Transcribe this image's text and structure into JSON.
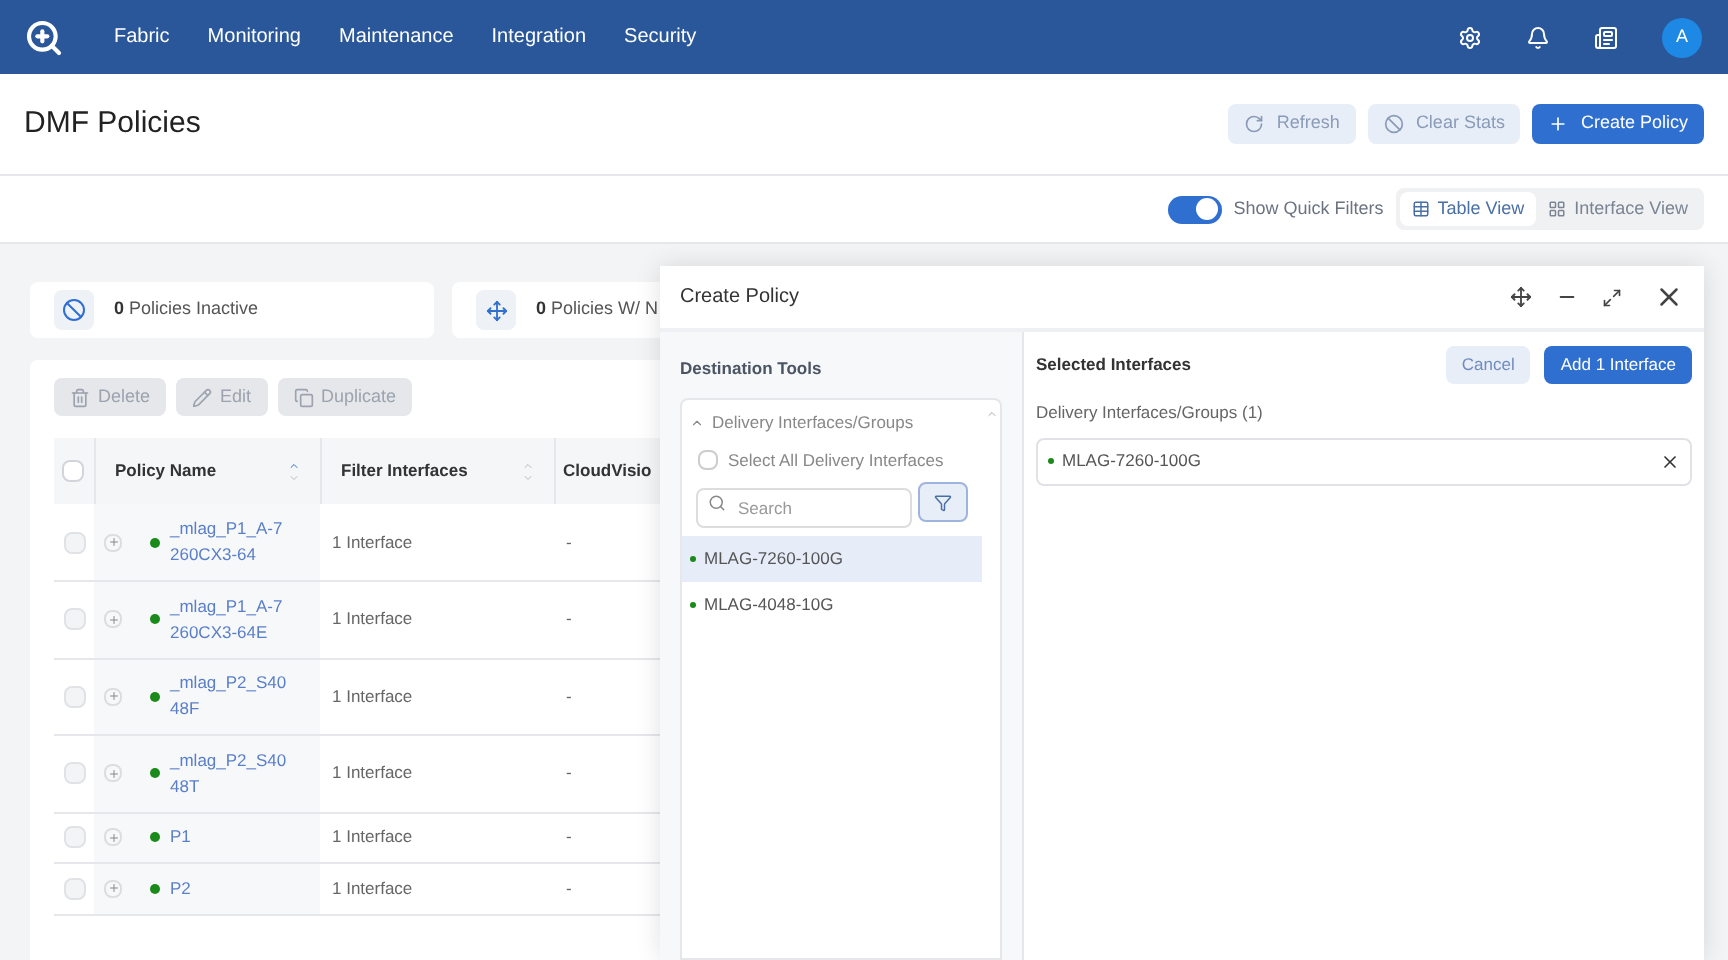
{
  "nav": {
    "items": [
      "Fabric",
      "Monitoring",
      "Maintenance",
      "Integration",
      "Security"
    ],
    "avatar": "A"
  },
  "page": {
    "title": "DMF Policies",
    "actions": [
      {
        "label": "Refresh",
        "kind": "refresh"
      },
      {
        "label": "Clear Stats",
        "kind": "clear"
      },
      {
        "label": "Create Policy",
        "kind": "create"
      }
    ]
  },
  "quick_filters": {
    "label": "Show Quick Filters",
    "on": true
  },
  "views": [
    {
      "label": "Table View",
      "selected": true
    },
    {
      "label": "Interface View",
      "selected": false
    }
  ],
  "stats": [
    {
      "count": "0",
      "label": "Policies Inactive"
    },
    {
      "count": "0",
      "label": "Policies W/ N"
    }
  ],
  "toolbar": [
    {
      "label": "Delete",
      "kind": "delete"
    },
    {
      "label": "Edit",
      "kind": "edit"
    },
    {
      "label": "Duplicate",
      "kind": "duplicate"
    }
  ],
  "table": {
    "all_checked": false,
    "columns": [
      "Policy Name",
      "Filter Interfaces",
      "CloudVisio"
    ],
    "rows": [
      {
        "checked": false,
        "name": "_mlag_P1_A-7260CX3-64",
        "filter": "1 Interface",
        "cloudvision": "-"
      },
      {
        "checked": false,
        "name": "_mlag_P1_A-7260CX3-64E",
        "filter": "1 Interface",
        "cloudvision": "-"
      },
      {
        "checked": false,
        "name": "_mlag_P2_S4048F",
        "filter": "1 Interface",
        "cloudvision": "-"
      },
      {
        "checked": false,
        "name": "_mlag_P2_S4048T",
        "filter": "1 Interface",
        "cloudvision": "-"
      },
      {
        "checked": false,
        "name": "P1",
        "filter": "1 Interface",
        "cloudvision": "-"
      },
      {
        "checked": false,
        "name": "P2",
        "filter": "1 Interface",
        "cloudvision": "-"
      }
    ]
  },
  "dialog": {
    "title": "Create Policy",
    "left": {
      "heading": "Destination Tools",
      "group": "Delivery Interfaces/Groups",
      "expanded": true,
      "select_all": {
        "label": "Select All Delivery Interfaces",
        "checked": false
      },
      "search": {
        "placeholder": "Search"
      },
      "items": [
        {
          "label": "MLAG-7260-100G",
          "selected": true
        },
        {
          "label": "MLAG-4048-10G",
          "selected": false
        }
      ]
    },
    "right": {
      "heading": "Selected Interfaces",
      "cancel": "Cancel",
      "add": "Add 1 Interface",
      "group_label": "Delivery Interfaces/Groups (1)",
      "selected": [
        "MLAG-7260-100G"
      ]
    }
  }
}
